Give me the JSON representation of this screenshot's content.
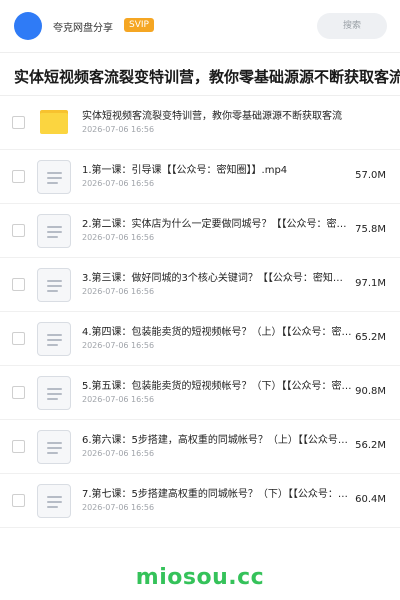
{
  "header": {
    "share_name": "夸克网盘分享",
    "badge": "SVIP",
    "search_placeholder": "搜索"
  },
  "title": "实体短视频客流裂变特训营，教你零基础源源不断获取客流",
  "items": [
    {
      "type": "folder",
      "name": "实体短视频客流裂变特训营，教你零基础源源不断获取客流",
      "date": "2026-07-06 16:56",
      "size": ""
    },
    {
      "type": "file",
      "name": "1.第一课：引导课【【公众号：密知圈】】.mp4",
      "date": "2026-07-06 16:56",
      "size": "57.0M"
    },
    {
      "type": "file",
      "name": "2.第二课：实体店为什么一定要做同城号？【【公众号：密知圈】】.mp4",
      "date": "2026-07-06 16:56",
      "size": "75.8M"
    },
    {
      "type": "file",
      "name": "3.第三课：做好同城的3个核心关键词？【【公众号：密知圈】】.mp4",
      "date": "2026-07-06 16:56",
      "size": "97.1M"
    },
    {
      "type": "file",
      "name": "4.第四课：包装能卖货的短视频帐号？（上）【【公众号：密知圈】】.mp4",
      "date": "2026-07-06 16:56",
      "size": "65.2M"
    },
    {
      "type": "file",
      "name": "5.第五课：包装能卖货的短视频帐号？（下）【【公众号：密知圈】】.mp4",
      "date": "2026-07-06 16:56",
      "size": "90.8M"
    },
    {
      "type": "file",
      "name": "6.第六课：5步搭建，高权重的同城帐号？（上）【【公众号：密知圈】】.mp4",
      "date": "2026-07-06 16:56",
      "size": "56.2M"
    },
    {
      "type": "file",
      "name": "7.第七课：5步搭建高权重的同城帐号？（下）【【公众号：密知圈】】.mp4",
      "date": "2026-07-06 16:56",
      "size": "60.4M"
    }
  ],
  "watermark": "miosou.cc",
  "colors": {
    "accent": "#2f7bf6",
    "badge": "#f5a623",
    "folder": "#fbd540",
    "watermark": "#35c25a"
  }
}
